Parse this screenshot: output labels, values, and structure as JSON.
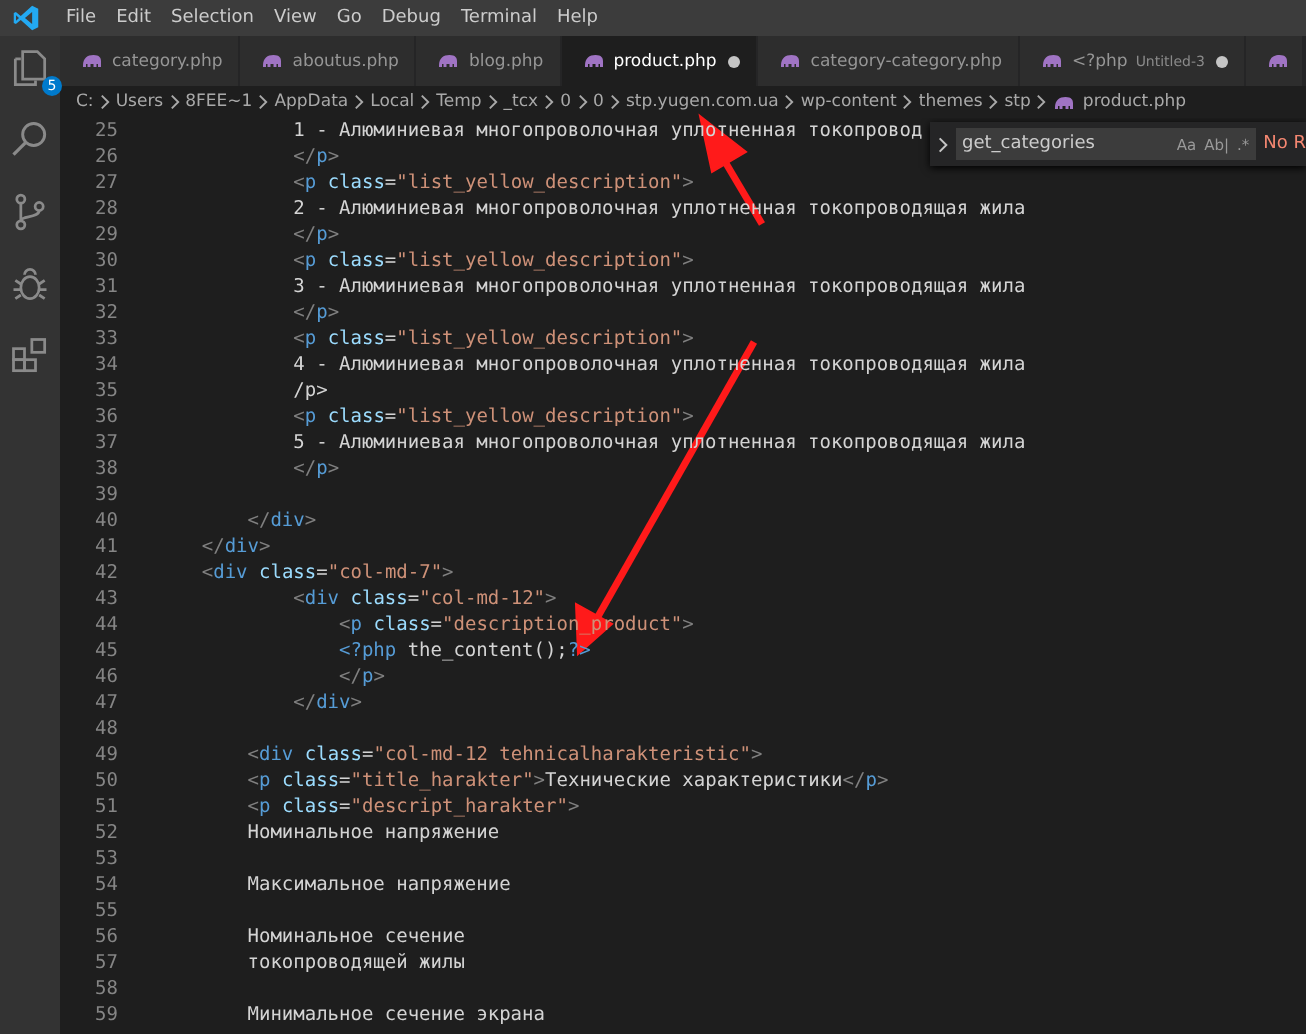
{
  "menu": [
    "File",
    "Edit",
    "Selection",
    "View",
    "Go",
    "Debug",
    "Terminal",
    "Help"
  ],
  "activity_bar": {
    "explorer_badge": "5"
  },
  "tabs": [
    {
      "label": "category.php",
      "selected": false,
      "dirty": false
    },
    {
      "label": "aboutus.php",
      "selected": false,
      "dirty": false
    },
    {
      "label": "blog.php",
      "selected": false,
      "dirty": false
    },
    {
      "label": "product.php",
      "selected": true,
      "dirty": true
    },
    {
      "label": "category-category.php",
      "selected": false,
      "dirty": false
    },
    {
      "label": "<?php",
      "description": "Untitled-3",
      "selected": false,
      "dirty": true
    }
  ],
  "breadcrumbs": [
    "C:",
    "Users",
    "8FEE~1",
    "AppData",
    "Local",
    "Temp",
    "_tcx",
    "0",
    "0",
    "stp.yugen.com.ua",
    "wp-content",
    "themes",
    "stp",
    "product.php"
  ],
  "find_widget": {
    "value": "get_categories",
    "options": [
      "Aa",
      "Ab|",
      ".*"
    ],
    "result": "No R"
  },
  "lines": [
    {
      "children": [
        {
          "children": [
            {
              "children": [
                {
                  "number": "25",
                  "tokens": [
                    {
                      "kind": "text",
                      "text": "1 - Алюминиевая многопроволочная уплотненная токопровод"
                    }
                  ]
                },
                {
                  "number": "26",
                  "tokens": [
                    {
                      "kind": "punct",
                      "text": "</"
                    },
                    {
                      "kind": "tag",
                      "text": "p"
                    },
                    {
                      "kind": "punct",
                      "text": ">"
                    }
                  ]
                },
                {
                  "number": "27",
                  "tokens": [
                    {
                      "kind": "punct",
                      "text": "<"
                    },
                    {
                      "kind": "tag",
                      "text": "p"
                    },
                    {
                      "kind": "attr",
                      "text": "class"
                    },
                    {
                      "kind": "text",
                      "text": "="
                    },
                    {
                      "kind": "string",
                      "text": "\"list_yellow_description\""
                    },
                    {
                      "kind": "punct",
                      "text": ">"
                    }
                  ]
                },
                {
                  "number": "28",
                  "tokens": [
                    {
                      "kind": "text",
                      "text": "2 - Алюминиевая многопроволочная уплотненная токопроводящая жила"
                    }
                  ]
                },
                {
                  "number": "29",
                  "tokens": [
                    {
                      "kind": "punct",
                      "text": "</"
                    },
                    {
                      "kind": "tag",
                      "text": "p"
                    },
                    {
                      "kind": "punct",
                      "text": ">"
                    }
                  ]
                },
                {
                  "number": "30",
                  "tokens": [
                    {
                      "kind": "punct",
                      "text": "<"
                    },
                    {
                      "kind": "tag",
                      "text": "p"
                    },
                    {
                      "kind": "attr",
                      "text": "class"
                    },
                    {
                      "kind": "text",
                      "text": "="
                    },
                    {
                      "kind": "string",
                      "text": "\"list_yellow_description\""
                    },
                    {
                      "kind": "punct",
                      "text": ">"
                    }
                  ]
                },
                {
                  "number": "31",
                  "tokens": [
                    {
                      "kind": "text",
                      "text": "3 - Алюминиевая многопроволочная уплотненная токопроводящая жила"
                    }
                  ]
                },
                {
                  "number": "32",
                  "tokens": [
                    {
                      "kind": "punct",
                      "text": "</"
                    },
                    {
                      "kind": "tag",
                      "text": "p"
                    },
                    {
                      "kind": "punct",
                      "text": ">"
                    }
                  ]
                },
                {
                  "number": "33",
                  "tokens": [
                    {
                      "kind": "punct",
                      "text": "<"
                    },
                    {
                      "kind": "tag",
                      "text": "p"
                    },
                    {
                      "kind": "attr",
                      "text": "class"
                    },
                    {
                      "kind": "text",
                      "text": "="
                    },
                    {
                      "kind": "string",
                      "text": "\"list_yellow_description\""
                    },
                    {
                      "kind": "punct",
                      "text": ">"
                    }
                  ]
                },
                {
                  "number": "34",
                  "tokens": [
                    {
                      "kind": "text",
                      "text": "4 - Алюминиевая многопроволочная уплотненная токопроводящая жила"
                    }
                  ]
                },
                {
                  "number": "35",
                  "tokens": [
                    {
                      "kind": "text",
                      "text": "/p>"
                    }
                  ]
                },
                {
                  "number": "36",
                  "tokens": [
                    {
                      "kind": "punct",
                      "text": "<"
                    },
                    {
                      "kind": "tag",
                      "text": "p"
                    },
                    {
                      "kind": "attr",
                      "text": "class"
                    },
                    {
                      "kind": "text",
                      "text": "="
                    },
                    {
                      "kind": "string",
                      "text": "\"list_yellow_description\""
                    },
                    {
                      "kind": "punct",
                      "text": ">"
                    }
                  ]
                },
                {
                  "number": "37",
                  "tokens": [
                    {
                      "kind": "text",
                      "text": "5 - Алюминиевая многопроволочная уплотненная токопроводящая жила"
                    }
                  ]
                },
                {
                  "number": "38",
                  "tokens": [
                    {
                      "kind": "punct",
                      "text": "</"
                    },
                    {
                      "kind": "tag",
                      "text": "p"
                    },
                    {
                      "kind": "punct",
                      "text": ">"
                    }
                  ]
                }
              ]
            }
          ]
        }
      ]
    },
    {
      "number": "39"
    },
    {
      "children": [
        {
          "children": [
            {
              "number": "40",
              "tokens": [
                {
                  "kind": "punct",
                  "text": "</"
                },
                {
                  "kind": "tag",
                  "text": "div"
                },
                {
                  "kind": "punct",
                  "text": ">"
                }
              ]
            }
          ]
        },
        {
          "number": "41",
          "tokens": [
            {
              "kind": "punct",
              "text": "</"
            },
            {
              "kind": "tag",
              "text": "div"
            },
            {
              "kind": "punct",
              "text": ">"
            }
          ]
        },
        {
          "number": "42",
          "tokens": [
            {
              "kind": "punct",
              "text": "<"
            },
            {
              "kind": "tag",
              "text": "div"
            },
            {
              "kind": "attr",
              "text": "class"
            },
            {
              "kind": "text",
              "text": "="
            },
            {
              "kind": "string",
              "text": "\"col-md-7\""
            },
            {
              "kind": "punct",
              "text": ">"
            }
          ]
        },
        {
          "children": [
            {
              "children": [
                {
                  "number": "43",
                  "tokens": [
                    {
                      "kind": "punct",
                      "text": "<"
                    },
                    {
                      "kind": "tag",
                      "text": "div"
                    },
                    {
                      "kind": "attr",
                      "text": "class"
                    },
                    {
                      "kind": "text",
                      "text": "="
                    },
                    {
                      "kind": "string",
                      "text": "\"col-md-12\""
                    },
                    {
                      "kind": "punct",
                      "text": ">"
                    }
                  ]
                },
                {
                  "children": [
                    {
                      "number": "44",
                      "tokens": [
                        {
                          "kind": "punct",
                          "text": "<"
                        },
                        {
                          "kind": "tag",
                          "text": "p"
                        },
                        {
                          "kind": "attr",
                          "text": "class"
                        },
                        {
                          "kind": "text",
                          "text": "="
                        },
                        {
                          "kind": "string",
                          "text": "\"description_product\""
                        },
                        {
                          "kind": "punct",
                          "text": ">"
                        }
                      ]
                    },
                    {
                      "number": "45",
                      "tokens": [
                        {
                          "kind": "tag",
                          "text": "<?php"
                        },
                        {
                          "kind": "call",
                          "text": "the_content();"
                        },
                        {
                          "kind": "tag",
                          "text": "?>"
                        }
                      ]
                    },
                    {
                      "number": "46",
                      "tokens": [
                        {
                          "kind": "punct",
                          "text": "</"
                        },
                        {
                          "kind": "tag",
                          "text": "p"
                        },
                        {
                          "kind": "punct",
                          "text": ">"
                        }
                      ]
                    }
                  ]
                },
                {
                  "number": "47",
                  "tokens": [
                    {
                      "kind": "punct",
                      "text": "</"
                    },
                    {
                      "kind": "tag",
                      "text": "div"
                    },
                    {
                      "kind": "punct",
                      "text": ">"
                    }
                  ]
                }
              ]
            }
          ]
        },
        {
          "number": "48"
        },
        {
          "children": [
            {
              "number": "49",
              "tokens": [
                {
                  "kind": "punct",
                  "text": "<"
                },
                {
                  "kind": "tag",
                  "text": "div"
                },
                {
                  "kind": "attr",
                  "text": "class"
                },
                {
                  "kind": "text",
                  "text": "="
                },
                {
                  "kind": "string",
                  "text": "\"col-md-12 tehnicalharakteristic\""
                },
                {
                  "kind": "punct",
                  "text": ">"
                }
              ]
            },
            {
              "number": "50",
              "tokens": [
                {
                  "kind": "punct",
                  "text": "<"
                },
                {
                  "kind": "tag",
                  "text": "p"
                },
                {
                  "kind": "attr",
                  "text": "class"
                },
                {
                  "kind": "text",
                  "text": "="
                },
                {
                  "kind": "string",
                  "text": "\"title_harakter\""
                },
                {
                  "kind": "punct",
                  "text": ">"
                },
                {
                  "kind": "text",
                  "text": "Технические характеристики"
                },
                {
                  "kind": "punct",
                  "text": "</"
                },
                {
                  "kind": "tag",
                  "text": "p"
                },
                {
                  "kind": "punct",
                  "text": ">"
                }
              ]
            },
            {
              "number": "51",
              "tokens": [
                {
                  "kind": "punct",
                  "text": "<"
                },
                {
                  "kind": "tag",
                  "text": "p"
                },
                {
                  "kind": "attr",
                  "text": "class"
                },
                {
                  "kind": "text",
                  "text": "="
                },
                {
                  "kind": "string",
                  "text": "\"descript_harakter\""
                },
                {
                  "kind": "punct",
                  "text": ">"
                }
              ]
            },
            {
              "number": "52",
              "tokens": [
                {
                  "kind": "text",
                  "text": "Номинальное напряжение"
                }
              ]
            },
            {
              "number": "53"
            },
            {
              "number": "54",
              "tokens": [
                {
                  "kind": "text",
                  "text": "Максимальное напряжение"
                }
              ]
            },
            {
              "number": "55"
            },
            {
              "number": "56",
              "tokens": [
                {
                  "kind": "text",
                  "text": "Номинальное сечение"
                }
              ]
            },
            {
              "number": "57",
              "tokens": [
                {
                  "kind": "text",
                  "text": "токопроводящей жилы"
                }
              ]
            },
            {
              "number": "58"
            },
            {
              "number": "59",
              "tokens": [
                {
                  "kind": "text",
                  "text": "Минимальное сечение экрана"
                }
              ]
            }
          ]
        }
      ]
    }
  ]
}
